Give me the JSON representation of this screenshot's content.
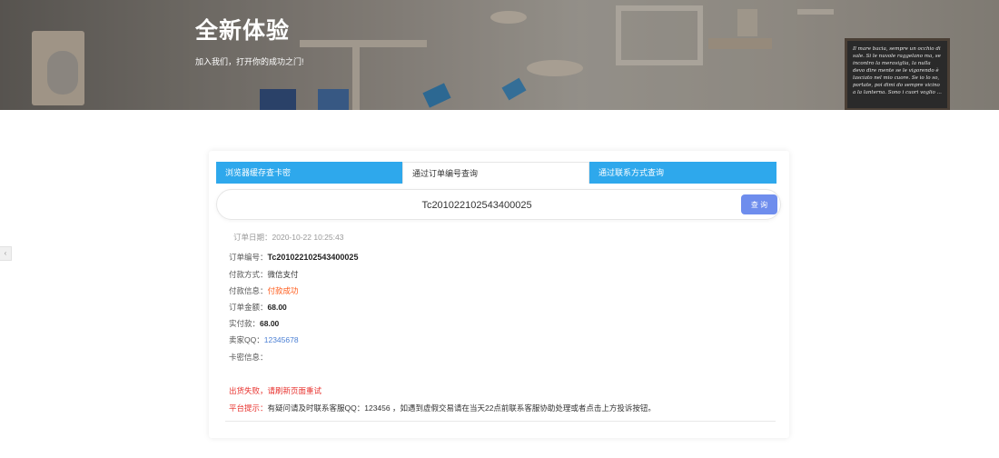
{
  "banner": {
    "title": "全新体验",
    "subtitle": "加入我们，打开你的成功之门!",
    "chalkboard_text": "Il mare bacia, sempre un occhio di sale. Si le nuvole raggelano ma, se incontro la meraviglia, la nulla devo dire mente se le vigorendo è lasciato nel mio cuore. Se io lo so, portate, poi dimi do sempre vicino a la lanterna. Sono i cuori voglio ..."
  },
  "edge_tab": {
    "glyph": "‹"
  },
  "tabs": [
    {
      "label": "浏览器缓存查卡密"
    },
    {
      "label": "通过订单编号查询"
    },
    {
      "label": "通过联系方式查询"
    }
  ],
  "search": {
    "value": "Tc201022102543400025",
    "button_label": "查 询"
  },
  "order": {
    "date_label": "订单日期：",
    "date_value": "2020-10-22 10:25:43",
    "fields": [
      {
        "label": "订单编号：",
        "value": "Tc201022102543400025"
      },
      {
        "label": "付款方式：",
        "value": "微信支付"
      },
      {
        "label": "付款信息：",
        "value": "付款成功"
      },
      {
        "label": "订单金额：",
        "value": "68.00"
      },
      {
        "label": "实付款：",
        "value": "68.00"
      },
      {
        "label": "卖家QQ：",
        "value": "12345678"
      },
      {
        "label": "卡密信息：",
        "value": ""
      }
    ],
    "fail_message": "出货失败，请刷新页面重试",
    "notice_label": "平台提示：",
    "notice_text": "有疑问请及时联系客服QQ：123456 ，如遇到虚假交易请在当天22点前联系客服协助处理或者点击上方投诉按钮。"
  },
  "colors": {
    "tab_blue": "#2ea8ec",
    "button": "#6e8ded",
    "success": "#ff5b1a",
    "error": "#e8322e",
    "link": "#4a7fd4"
  }
}
